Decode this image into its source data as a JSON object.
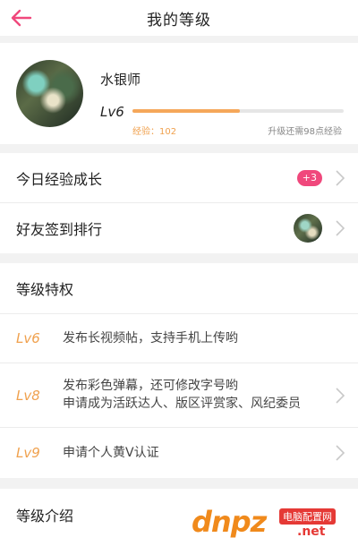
{
  "header": {
    "title": "我的等级",
    "back_icon": "back-arrow-icon",
    "accent_color": "#f0487c"
  },
  "profile": {
    "username": "水银师",
    "level": "Lv6",
    "progress_fraction": 0.51,
    "exp_text": "经验：102",
    "next_level_text": "升级还需98点经验",
    "bar_color": "#f5a75a"
  },
  "rows": {
    "daily_growth": {
      "label": "今日经验成长",
      "badge": "+3"
    },
    "friend_rank": {
      "label": "好友签到排行"
    }
  },
  "privileges": {
    "title": "等级特权",
    "items": [
      {
        "level": "Lv6",
        "text_line1": "发布长视频帖，支持手机上传哟",
        "text_line2": ""
      },
      {
        "level": "Lv8",
        "text_line1": "发布彩色弹幕，还可修改字号哟",
        "text_line2": "申请成为活跃达人、版区评赏家、风纪委员"
      },
      {
        "level": "Lv9",
        "text_line1": "申请个人黄V认证",
        "text_line2": ""
      }
    ]
  },
  "intro": {
    "title": "等级介绍"
  },
  "watermark": {
    "main": "dnpz",
    "sub": "电脑配置网",
    "net": ".net"
  }
}
